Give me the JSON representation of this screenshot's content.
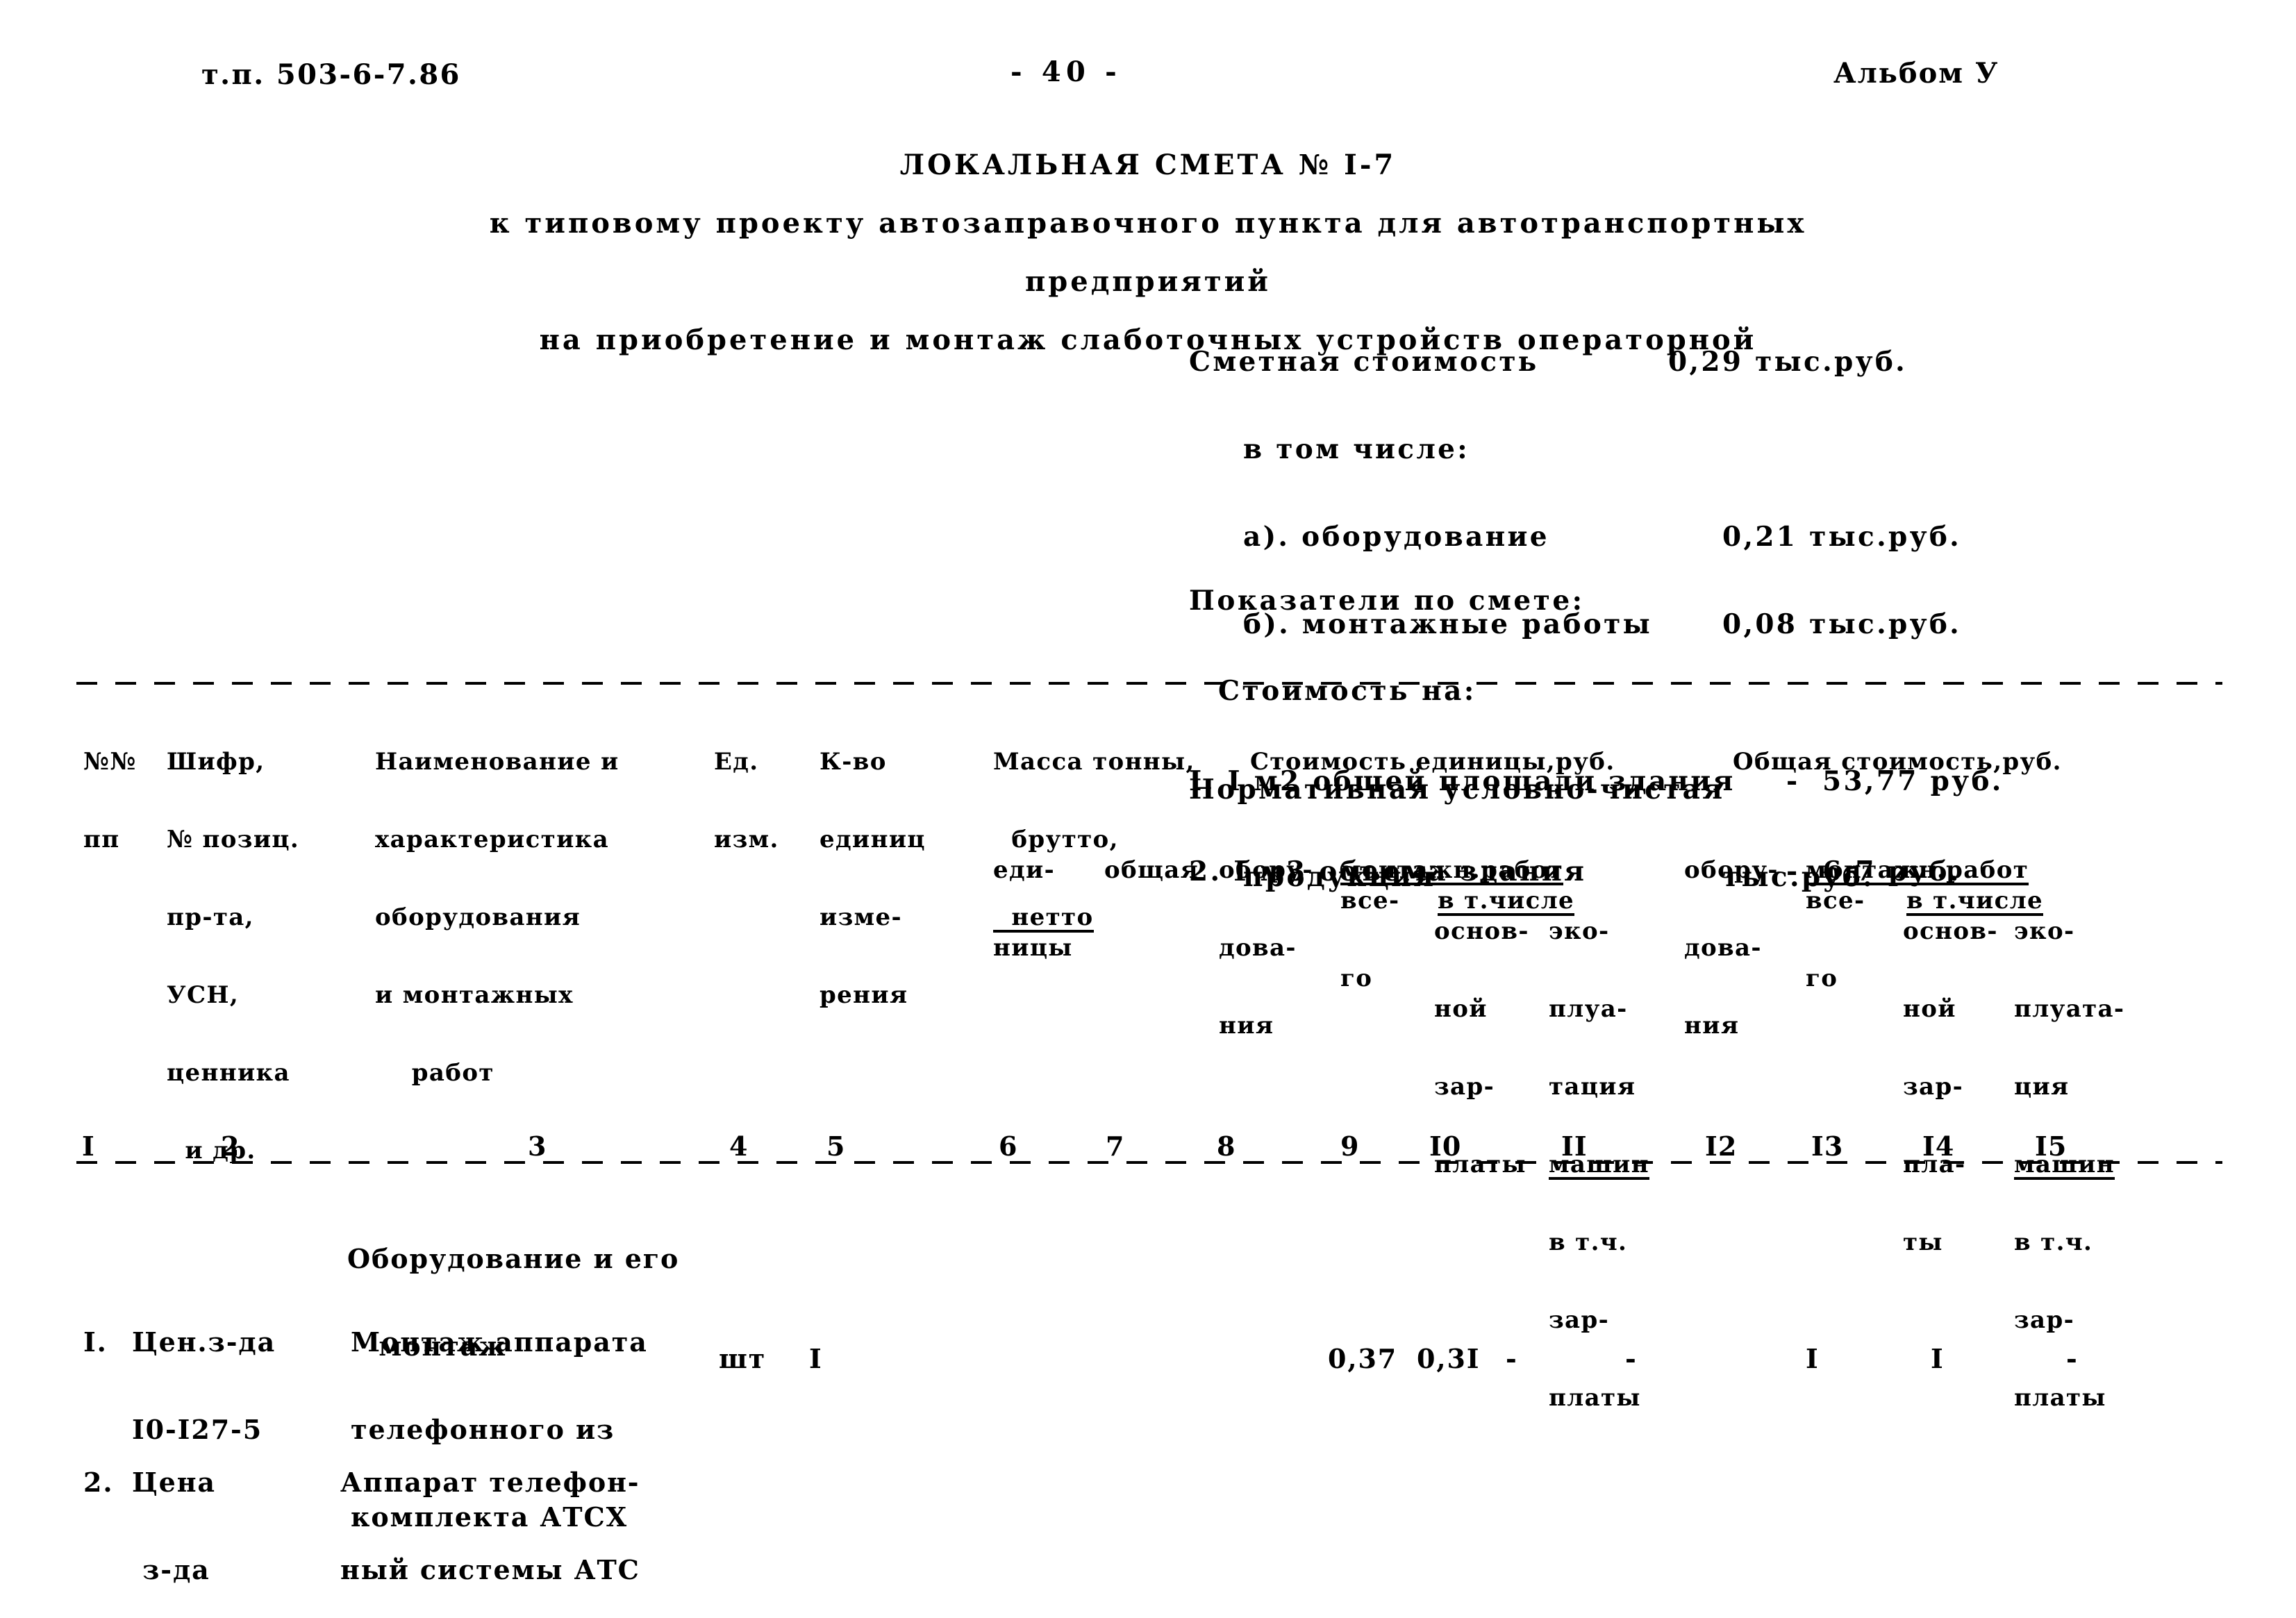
{
  "header": {
    "doc_code": "т.п. 503-6-7.86",
    "page_number": "- 40 -",
    "album": "Альбом У"
  },
  "title": {
    "line1": "ЛОКАЛЬНАЯ СМЕТА № I-7",
    "line2": "к типовому проекту автозаправочного пункта для автотранспортных",
    "line3": "предприятий",
    "line4": "на приобретение и монтаж слаботочных устройств операторной"
  },
  "summary": {
    "estimate_cost_label": "Сметная стоимость",
    "estimate_cost_value": "0,29 тыс.руб.",
    "including_label": "в том числе:",
    "equipment_label": "а). оборудование",
    "equipment_value": "0,21 тыс.руб.",
    "install_label": "б). монтажные работы",
    "install_value": "0,08 тыс.руб.",
    "nucp_label_1": "Нормативная условно-чистая",
    "nucp_label_2": "продукция",
    "nucp_value": "тыс.руб."
  },
  "indicators": {
    "heading": "Показатели по смете:",
    "subheading": "Стоимость на:",
    "items": [
      {
        "text": "I. I м2 общей площади здания",
        "dash": "-",
        "value": "53,77 руб."
      },
      {
        "text": "2. I м3 объема здания",
        "dash": "-",
        "value": "6,7 руб."
      }
    ]
  },
  "table": {
    "headers": {
      "col1": [
        "№№",
        "пп"
      ],
      "col2": [
        "Шифр,",
        "№ позиц.",
        "пр-та,",
        "УСН,",
        "ценника",
        "  и др."
      ],
      "col3": [
        "Наименование и",
        "характеристика",
        "оборудования",
        "и монтажных",
        "    работ"
      ],
      "col4": [
        "Ед.",
        "изм."
      ],
      "col5": [
        "К-во",
        "единиц",
        "изме-",
        "рения"
      ],
      "mass_group": [
        "Масса тонны,",
        "  брутто,",
        "  нетто"
      ],
      "col6": [
        "еди-",
        "ницы"
      ],
      "col7": [
        "общая"
      ],
      "unit_cost_group": "Стоимость единицы,руб.",
      "total_cost_group": "Общая стоимость,руб.",
      "col8": [
        "обору-",
        "дова-",
        "ния"
      ],
      "install_group_left": "монтажн.работ",
      "col9": [
        "все-",
        "го"
      ],
      "incl_left": "в т.числе",
      "col10": [
        "основ-",
        "ной",
        "зар-",
        "платы"
      ],
      "col11": [
        "эко-",
        "плуа-",
        "тация",
        "машин",
        "в т.ч.",
        "зар-",
        "платы"
      ],
      "col12": [
        "обору-",
        "дова-",
        "ния"
      ],
      "install_group_right": "монтажн.работ",
      "col13": [
        "все-",
        "го"
      ],
      "incl_right": "в т.числе",
      "col14": [
        "основ-",
        "ной",
        "зар-",
        "пла-",
        "ты"
      ],
      "col15": [
        "эко-",
        "плуата-",
        "ция",
        "машин",
        "в т.ч.",
        "зар-",
        "платы"
      ]
    },
    "column_numbers": [
      "I",
      "2",
      "3",
      "4",
      "5",
      "6",
      "7",
      "8",
      "9",
      "I0",
      "II",
      "I2",
      "I3",
      "I4",
      "I5"
    ],
    "section_title": [
      "Оборудование и его",
      "   монтаж"
    ],
    "rows": [
      {
        "no": "I.",
        "code": [
          "Цен.з-да",
          "I0-I27-5"
        ],
        "name": [
          "Монтаж аппарата",
          "телефонного из",
          "комплекта АТСХ"
        ],
        "unit": "шт",
        "qty": "I",
        "mass_unit": "",
        "mass_total": "",
        "unit_equip": "",
        "unit_install_total": "0,37",
        "unit_install_basic": "0,3I",
        "unit_install_mach": "-",
        "total_equip": "-",
        "total_install_total": "I",
        "total_install_basic": "I",
        "total_install_mach": "-"
      },
      {
        "no": "2.",
        "code": [
          "Цена",
          " з-да"
        ],
        "name": [
          "Аппарат телефон-",
          "ный системы АТС"
        ],
        "unit": "",
        "qty": "",
        "mass_unit": "",
        "mass_total": "",
        "unit_equip": "",
        "unit_install_total": "",
        "unit_install_basic": "",
        "unit_install_mach": "",
        "total_equip": "",
        "total_install_total": "",
        "total_install_basic": "",
        "total_install_mach": ""
      }
    ]
  }
}
